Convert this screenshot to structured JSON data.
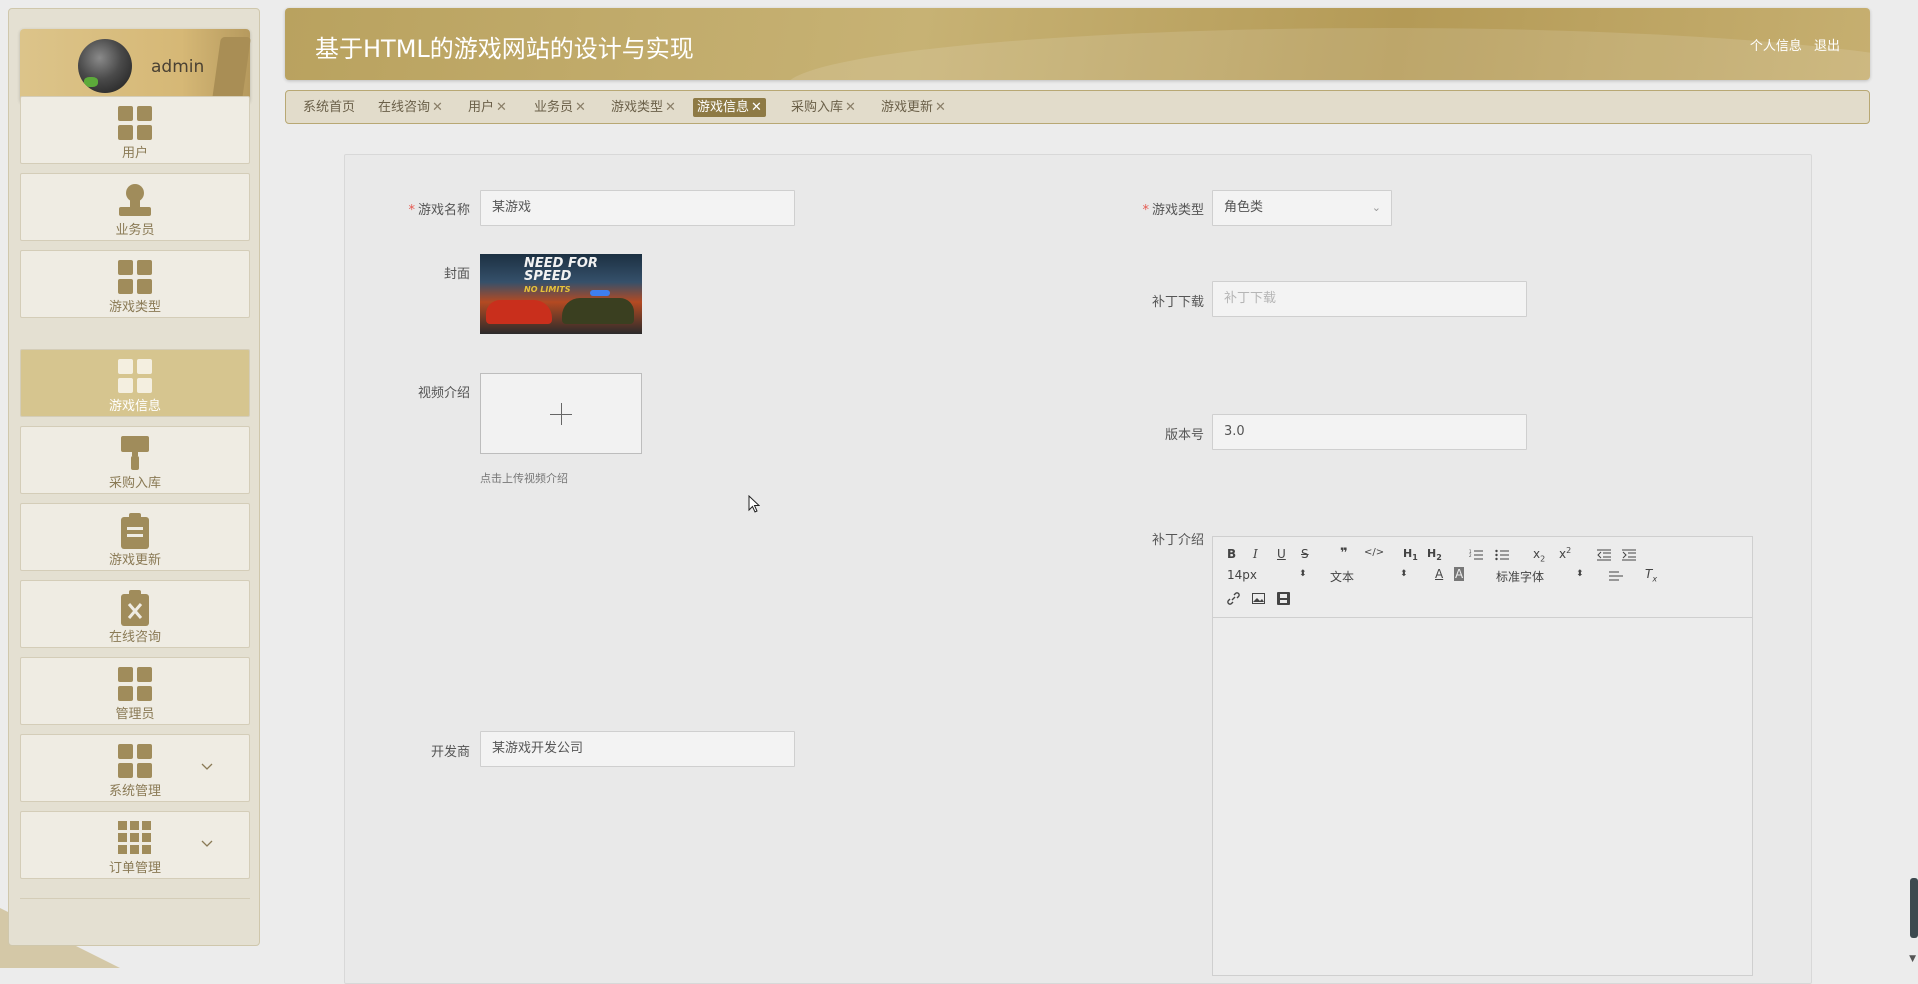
{
  "app": {
    "title": "基于HTML的游戏网站的设计与实现",
    "header_links": [
      "个人信息",
      "退出"
    ]
  },
  "user": {
    "name": "admin"
  },
  "sidebar": {
    "items": [
      {
        "label": "用户",
        "icon": "grid-icon"
      },
      {
        "label": "业务员",
        "icon": "person-icon"
      },
      {
        "label": "游戏类型",
        "icon": "grid-icon"
      },
      {
        "label": "游戏信息",
        "icon": "grid-icon",
        "active": true
      },
      {
        "label": "采购入库",
        "icon": "paint-roller-icon"
      },
      {
        "label": "游戏更新",
        "icon": "clipboard-icon"
      },
      {
        "label": "在线咨询",
        "icon": "clipboard-x-icon"
      },
      {
        "label": "管理员",
        "icon": "grid-icon"
      },
      {
        "label": "系统管理",
        "icon": "grid-icon",
        "expandable": true
      },
      {
        "label": "订单管理",
        "icon": "apps-icon",
        "expandable": true
      }
    ]
  },
  "tabs": [
    {
      "label": "系统首页",
      "closable": false
    },
    {
      "label": "在线咨询",
      "closable": true
    },
    {
      "label": "用户",
      "closable": true
    },
    {
      "label": "业务员",
      "closable": true
    },
    {
      "label": "游戏类型",
      "closable": true
    },
    {
      "label": "游戏信息",
      "closable": true,
      "active": true
    },
    {
      "label": "采购入库",
      "closable": true
    },
    {
      "label": "游戏更新",
      "closable": true
    }
  ],
  "tab_close_glyph": "✕",
  "form": {
    "game_name": {
      "label": "游戏名称",
      "value": "某游戏",
      "required": true
    },
    "game_type": {
      "label": "游戏类型",
      "value": "角色类",
      "required": true
    },
    "cover": {
      "label": "封面",
      "image_text": [
        "NEED FOR",
        "SPEED",
        "NO LIMITS"
      ]
    },
    "patch_download": {
      "label": "补丁下载",
      "placeholder": "补丁下载",
      "value": ""
    },
    "video_intro": {
      "label": "视频介绍",
      "hint": "点击上传视频介绍"
    },
    "version": {
      "label": "版本号",
      "value": "3.0"
    },
    "patch_intro": {
      "label": "补丁介绍"
    },
    "developer": {
      "label": "开发商",
      "value": "某游戏开发公司"
    }
  },
  "editor": {
    "font_size": "14px",
    "paragraph": "文本",
    "font_family": "标准字体",
    "buttons": [
      "B",
      "I",
      "U",
      "S",
      "❞",
      "</>",
      "H1",
      "H2",
      "ol",
      "ul",
      "x₂",
      "x²",
      "outdent",
      "indent",
      "A",
      "A-bg",
      "align",
      "Tx",
      "link",
      "image",
      "video"
    ]
  },
  "colors": {
    "accent": "#b9a25f",
    "active_tab": "#8e7a45",
    "active_menu": "#d6c58f",
    "required": "#e5584f"
  }
}
